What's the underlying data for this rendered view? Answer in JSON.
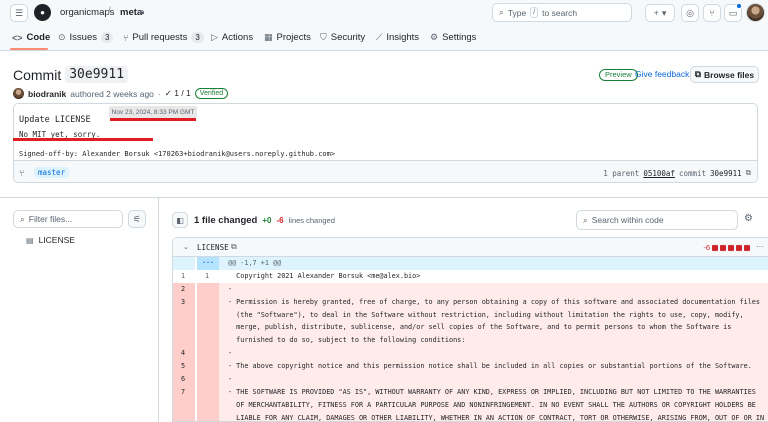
{
  "header": {
    "owner": "organicmaps",
    "separator": "/",
    "repo": "meta",
    "search_label": "Type",
    "search_key": "/",
    "search_suffix": "to search",
    "plus_label": "+",
    "plus_caret": "▾"
  },
  "nav": {
    "tabs": [
      {
        "label": "Code",
        "icon": "code-icon"
      },
      {
        "label": "Issues",
        "count": "3",
        "icon": "issue-icon"
      },
      {
        "label": "Pull requests",
        "count": "3",
        "icon": "pull-request-icon"
      },
      {
        "label": "Actions",
        "icon": "play-icon"
      },
      {
        "label": "Projects",
        "icon": "table-icon"
      },
      {
        "label": "Security",
        "icon": "shield-icon"
      },
      {
        "label": "Insights",
        "icon": "graph-icon"
      },
      {
        "label": "Settings",
        "icon": "gear-icon"
      }
    ]
  },
  "commit": {
    "title_prefix": "Commit",
    "short_sha": "30e9911",
    "preview": "Preview",
    "feedback": "Give feedback",
    "browse": "Browse files",
    "author": "biodranik",
    "authored": "authored 2 weeks ago",
    "dot": "·",
    "checks": "✓ 1 / 1",
    "verified": "Verified",
    "tooltip": "Nov 23, 2024, 8:33 PM GMT",
    "subject": "Update LICENSE",
    "body": "No MIT yet, sorry.",
    "signoff": "Signed-off-by: Alexander Borsuk <170263+biodranik@users.noreply.github.com>",
    "branch": "master",
    "parent_label": "1 parent",
    "parent_sha": "05100af",
    "commit_label": "commit",
    "full_sha": "30e9911"
  },
  "sidebar": {
    "filter_placeholder": "Filter files...",
    "files": [
      "LICENSE"
    ]
  },
  "diff": {
    "summary": "1 file changed",
    "additions": "+0",
    "deletions": "-6",
    "lines_label": "lines changed",
    "search_placeholder": "Search within code",
    "filename": "LICENSE",
    "diffstat": "-6",
    "hunk": "@@ -1,7 +1 @@",
    "expand": "···",
    "lines": [
      {
        "type": "ctx",
        "old": "1",
        "new": "1",
        "text": "  Copyright 2021 Alexander Borsuk <me@alex.bio>"
      },
      {
        "type": "del",
        "old": "2",
        "new": "",
        "text": "- "
      },
      {
        "type": "del",
        "old": "3",
        "new": "",
        "text": "- Permission is hereby granted, free of charge, to any person obtaining a copy of this software and associated documentation files"
      },
      {
        "type": "del",
        "old": "",
        "new": "",
        "text": "  (the \"Software\"), to deal in the Software without restriction, including without limitation the rights to use, copy, modify,"
      },
      {
        "type": "del",
        "old": "",
        "new": "",
        "text": "  merge, publish, distribute, sublicense, and/or sell copies of the Software, and to permit persons to whom the Software is"
      },
      {
        "type": "del",
        "old": "",
        "new": "",
        "text": "  furnished to do so, subject to the following conditions:"
      },
      {
        "type": "del",
        "old": "4",
        "new": "",
        "text": "- "
      },
      {
        "type": "del",
        "old": "5",
        "new": "",
        "text": "- The above copyright notice and this permission notice shall be included in all copies or substantial portions of the Software."
      },
      {
        "type": "del",
        "old": "6",
        "new": "",
        "text": "- "
      },
      {
        "type": "del",
        "old": "7",
        "new": "",
        "text": "- THE SOFTWARE IS PROVIDED \"AS IS\", WITHOUT WARRANTY OF ANY KIND, EXPRESS OR IMPLIED, INCLUDING BUT NOT LIMITED TO THE WARRANTIES"
      },
      {
        "type": "del",
        "old": "",
        "new": "",
        "text": "  OF MERCHANTABILITY, FITNESS FOR A PARTICULAR PURPOSE AND NONINFRINGEMENT. IN NO EVENT SHALL THE AUTHORS OR COPYRIGHT HOLDERS BE"
      },
      {
        "type": "del",
        "old": "",
        "new": "",
        "text": "  LIABLE FOR ANY CLAIM, DAMAGES OR OTHER LIABILITY, WHETHER IN AN ACTION OF CONTRACT, TORT OR OTHERWISE, ARISING FROM, OUT OF OR IN"
      }
    ]
  },
  "colors": {
    "accent": "#0969da",
    "tab_underline": "#fd8c73",
    "addition": "#1a7f37",
    "deletion": "#d1242f",
    "annotation_red": "#e11d21"
  }
}
